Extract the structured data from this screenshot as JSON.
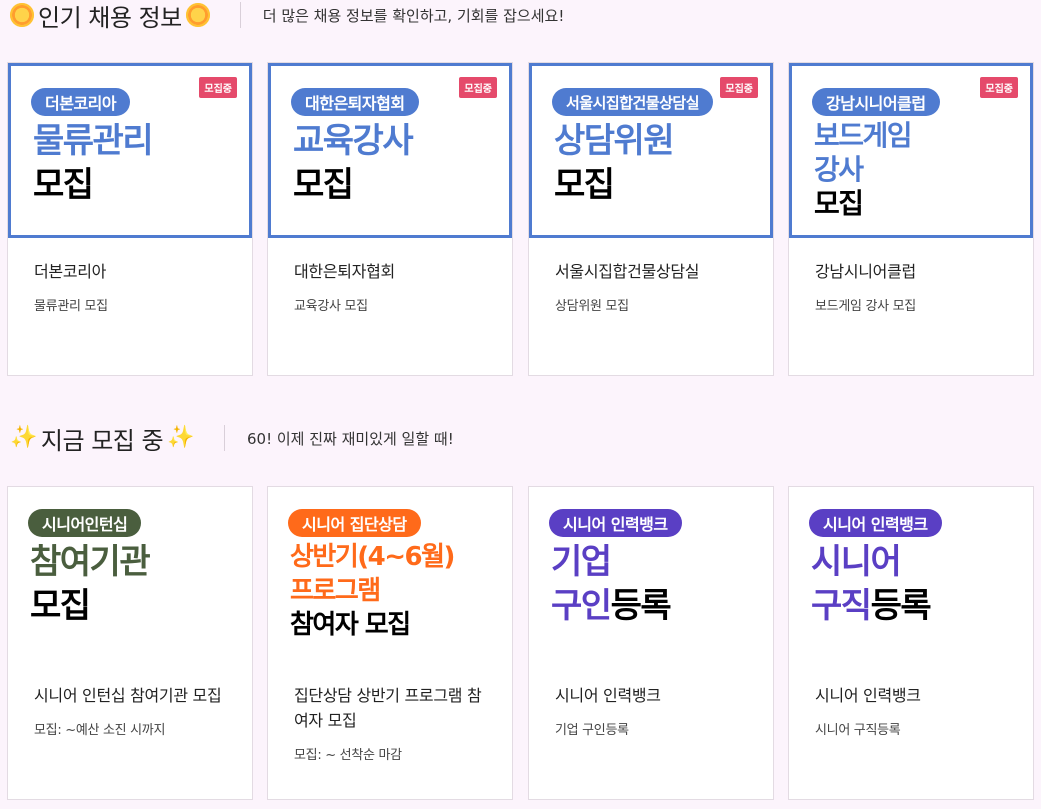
{
  "sections": [
    {
      "title": "인기 채용 정보",
      "subtitle": "더 많은 채용 정보를 확인하고, 기회를 잡으세요!",
      "cards": [
        {
          "pill": "더본코리아",
          "badge": "모집중",
          "big1": "물류관리",
          "big2": "모집",
          "title": "더본코리아",
          "desc": "물류관리 모집"
        },
        {
          "pill": "대한은퇴자협회",
          "badge": "모집중",
          "big1": "교육강사",
          "big2": "모집",
          "title": "대한은퇴자협회",
          "desc": "교육강사 모집"
        },
        {
          "pill": "서울시집합건물상담실",
          "badge": "모집중",
          "big1": "상담위원",
          "big2": "모집",
          "title": "서울시집합건물상담실",
          "desc": "상담위원 모집"
        },
        {
          "pill": "강남시니어클럽",
          "badge": "모집중",
          "big1": "보드게임",
          "big1b": "강사",
          "big2": "모집",
          "title": "강남시니어클럽",
          "desc": "보드게임 강사 모집"
        }
      ]
    },
    {
      "title": "지금 모집 중",
      "subtitle": "60! 이제 진짜 재미있게 일할 때!",
      "cards": [
        {
          "pill": "시니어인턴십",
          "big1": "참여기관",
          "big2": "모집",
          "title": "시니어 인턴십 참여기관 모집",
          "desc": "모집: ~예산 소진 시까지"
        },
        {
          "pill": "시니어 집단상담",
          "big1": "상반기(4~6월)",
          "big1b": "프로그램",
          "big2": "참여자 모집",
          "title": "집단상담 상반기 프로그램 참여자 모집",
          "desc": "모집: ~ 선착순 마감"
        },
        {
          "pill": "시니어 인력뱅크",
          "big1": "기업",
          "big2a": "구인",
          "big2b": "등록",
          "title": "시니어 인력뱅크",
          "desc": "기업 구인등록"
        },
        {
          "pill": "시니어 인력뱅크",
          "big1": "시니어",
          "big2a": "구직",
          "big2b": "등록",
          "title": "시니어 인력뱅크",
          "desc": "시니어 구직등록"
        }
      ]
    }
  ],
  "colors": {
    "blue_text": "#4f7bd0",
    "blue_pill": "#4f7bd0",
    "green_pill": "#4a5e3e",
    "green_text": "#4a5e3e",
    "orange": "#ff6a1a",
    "purple": "#5a3fc4",
    "badge": "#e54a6b"
  }
}
